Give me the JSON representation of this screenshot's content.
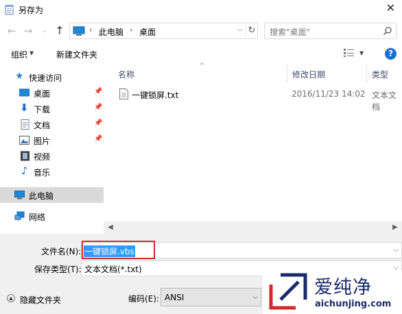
{
  "window": {
    "title": "另存为"
  },
  "address": {
    "parts": [
      "此电脑",
      "桌面"
    ]
  },
  "search": {
    "placeholder": "搜索\"桌面\""
  },
  "toolbar": {
    "organize": "组织",
    "new_folder": "新建文件夹",
    "help": "?"
  },
  "nav": {
    "quick_access": "快速访问",
    "items": [
      {
        "label": "桌面",
        "icon": "desktop-icon",
        "pinned": true
      },
      {
        "label": "下载",
        "icon": "download-icon",
        "pinned": true
      },
      {
        "label": "文档",
        "icon": "document-icon",
        "pinned": true
      },
      {
        "label": "图片",
        "icon": "picture-icon",
        "pinned": true
      },
      {
        "label": "视频",
        "icon": "video-icon",
        "pinned": false
      },
      {
        "label": "音乐",
        "icon": "music-icon",
        "pinned": false
      }
    ],
    "this_pc": "此电脑",
    "network": "网络"
  },
  "files": {
    "columns": [
      "名称",
      "修改日期",
      "类型"
    ],
    "rows": [
      {
        "name": "一键锁屏.txt",
        "modified": "2016/11/23 14:02",
        "type": "文本文档"
      }
    ]
  },
  "form": {
    "filename_label": "文件名(N):",
    "filename_value": "一键锁屏.vbs",
    "filetype_label": "保存类型(T):",
    "filetype_value": "文本文档(*.txt)",
    "hide_folders": "隐藏文件夹",
    "encoding_label": "编码(E):",
    "encoding_value": "ANSI"
  },
  "watermark": {
    "name": "爱纯净",
    "url": "aichunjing.com"
  },
  "colors": {
    "accent": "#3399ff",
    "highlight_box": "#d12b2b",
    "help": "#1a6fd0",
    "brand": "#1b2b6b"
  }
}
